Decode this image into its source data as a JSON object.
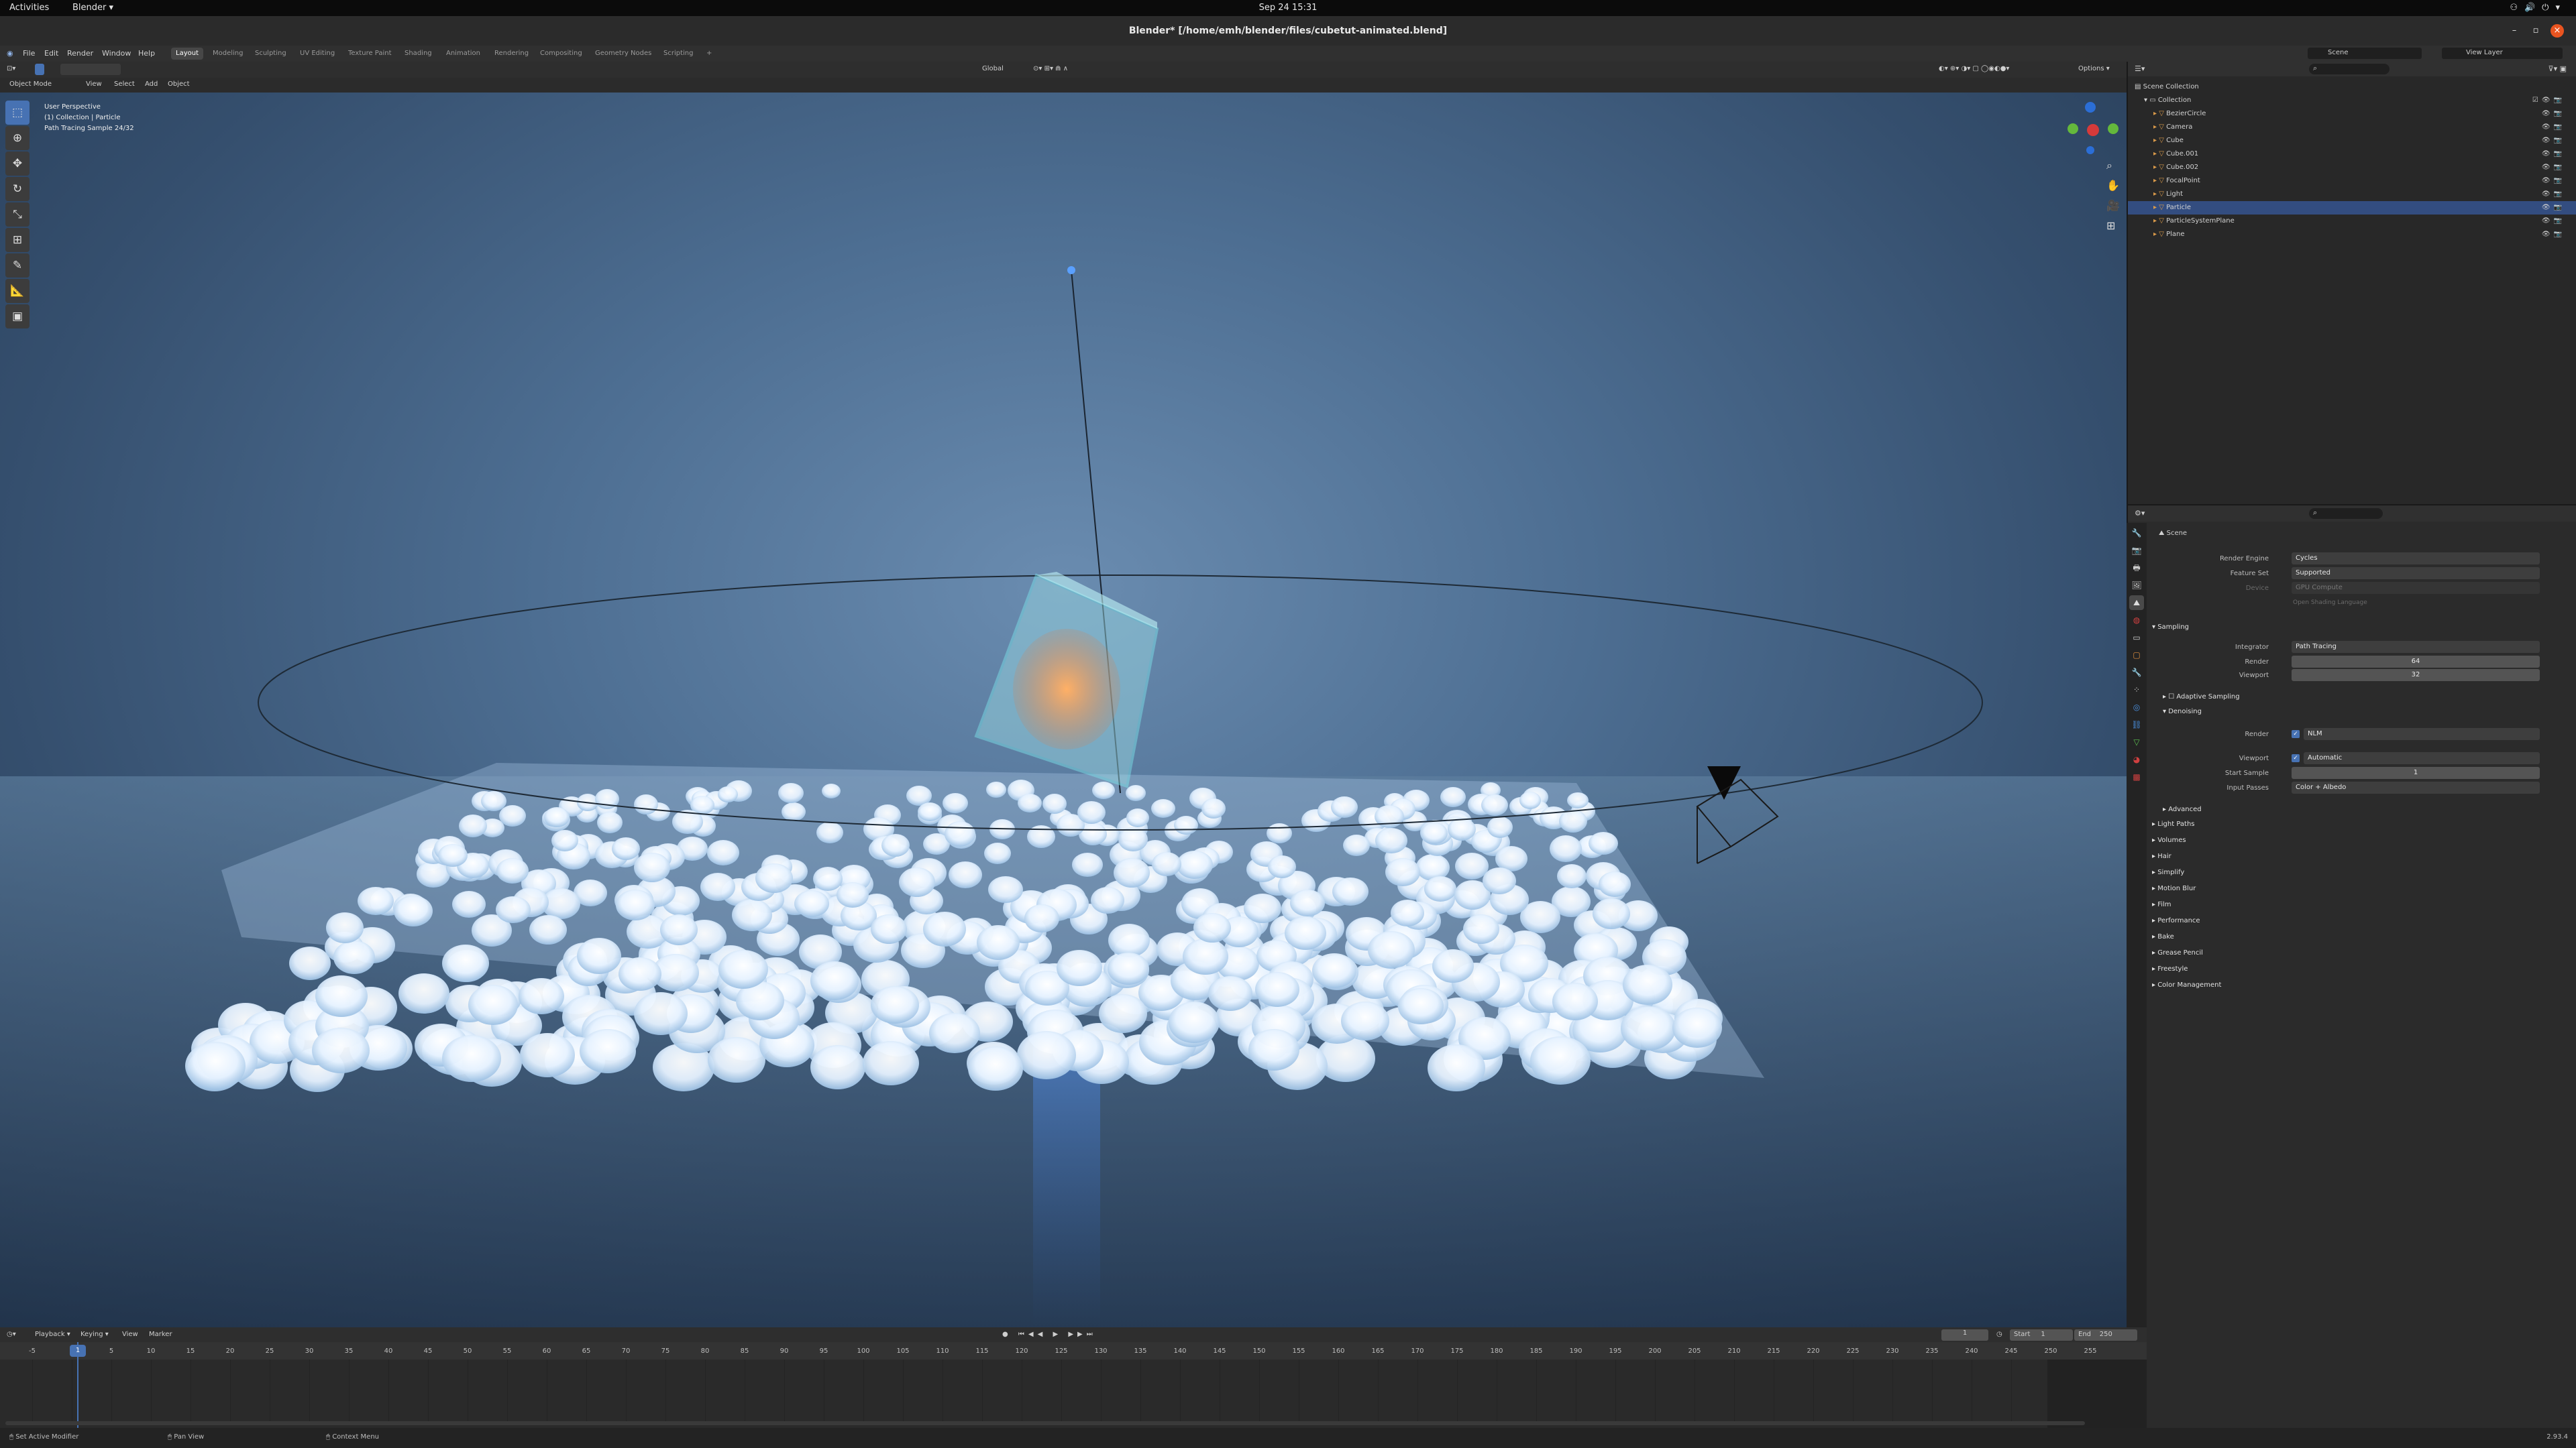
{
  "gnome": {
    "activities": "Activities",
    "app_menu": "Blender ▾",
    "clock": "Sep 24  15:31",
    "tray": "⚇🔊⏻▾"
  },
  "window": {
    "title": "Blender* [/home/emh/blender/files/cubetut-animated.blend]",
    "minimize": "–",
    "maximize": "▫",
    "close": "×"
  },
  "menu": {
    "items": [
      "File",
      "Edit",
      "Render",
      "Window",
      "Help"
    ],
    "workspaces": [
      "Layout",
      "Modeling",
      "Sculpting",
      "UV Editing",
      "Texture Paint",
      "Shading",
      "Animation",
      "Rendering",
      "Compositing",
      "Geometry Nodes",
      "Scripting",
      "+"
    ],
    "active_workspace": "Layout",
    "scene_label": "Scene",
    "view_layer_label": "View Layer"
  },
  "viewport_header": {
    "mode": "Object Mode",
    "menus": [
      "View",
      "Select",
      "Add",
      "Object"
    ],
    "transform": "Global",
    "options": "Options ▾"
  },
  "viewport": {
    "overlay_lines": [
      "User Perspective",
      "(1) Collection | Particle",
      "Path Tracing Sample 24/32"
    ],
    "gizmo_axes": [
      "X",
      "Y",
      "Z"
    ]
  },
  "outliner": {
    "search_placeholder": "⌕",
    "scene_collection": "Scene Collection",
    "collection": "Collection",
    "items": [
      {
        "name": "BezierCircle",
        "selected": false
      },
      {
        "name": "Camera",
        "selected": false
      },
      {
        "name": "Cube",
        "selected": false
      },
      {
        "name": "Cube.001",
        "selected": false
      },
      {
        "name": "Cube.002",
        "selected": false
      },
      {
        "name": "FocalPoint",
        "selected": false
      },
      {
        "name": "Light",
        "selected": false
      },
      {
        "name": "Particle",
        "selected": true
      },
      {
        "name": "ParticleSystemPlane",
        "selected": false
      },
      {
        "name": "Plane",
        "selected": false
      }
    ]
  },
  "properties": {
    "context": "Scene",
    "render_engine_label": "Render Engine",
    "render_engine": "Cycles",
    "feature_set_label": "Feature Set",
    "feature_set": "Supported",
    "device_label": "Device",
    "device": "GPU Compute",
    "osl": "Open Shading Language",
    "sampling": "Sampling",
    "integrator_label": "Integrator",
    "integrator": "Path Tracing",
    "render_label": "Render",
    "render_samples": "64",
    "viewport_label": "Viewport",
    "viewport_samples": "32",
    "adaptive_sampling": "Adaptive Sampling",
    "denoising": "Denoising",
    "denoise_render_label": "Render",
    "denoise_render": "NLM",
    "denoise_viewport_label": "Viewport",
    "denoise_viewport": "Automatic",
    "start_sample_label": "Start Sample",
    "start_sample": "1",
    "input_passes_label": "Input Passes",
    "input_passes": "Color + Albedo",
    "advanced": "Advanced",
    "collapsed_panels": [
      "Light Paths",
      "Volumes",
      "Hair",
      "Simplify",
      "Motion Blur",
      "Film",
      "Performance",
      "Bake",
      "Grease Pencil",
      "Freestyle",
      "Color Management"
    ]
  },
  "timeline": {
    "menus": [
      "Playback ▾",
      "Keying ▾",
      "View",
      "Marker"
    ],
    "current_frame": "1",
    "start_label": "Start",
    "start": "1",
    "end_label": "End",
    "end": "250",
    "ticks": [
      "-5",
      "0",
      "5",
      "10",
      "15",
      "20",
      "25",
      "30",
      "35",
      "40",
      "45",
      "50",
      "55",
      "60",
      "65",
      "70",
      "75",
      "80",
      "85",
      "90",
      "95",
      "100",
      "105",
      "110",
      "115",
      "120",
      "125",
      "130",
      "135",
      "140",
      "145",
      "150",
      "155",
      "160",
      "165",
      "170",
      "175",
      "180",
      "185",
      "190",
      "195",
      "200",
      "205",
      "210",
      "215",
      "220",
      "225",
      "230",
      "235",
      "240",
      "245",
      "250",
      "255"
    ]
  },
  "statusbar": {
    "left": "Set Active Modifier",
    "middle": "Pan View",
    "right_hint": "Context Menu",
    "version": "2.93.4"
  }
}
